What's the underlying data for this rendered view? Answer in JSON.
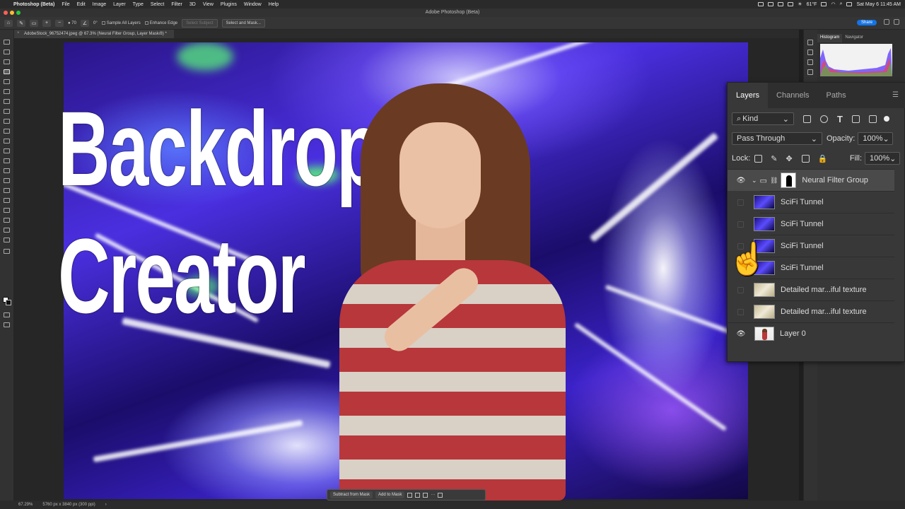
{
  "menubar": {
    "app": "Photoshop (Beta)",
    "items": [
      "File",
      "Edit",
      "Image",
      "Layer",
      "Type",
      "Select",
      "Filter",
      "3D",
      "View",
      "Plugins",
      "Window",
      "Help"
    ],
    "weather": "61°F",
    "datetime": "Sat May 6  11:45 AM"
  },
  "window": {
    "title": "Adobe Photoshop (Beta)"
  },
  "options": {
    "sample_all_layers": "Sample All Layers",
    "enhance_edge": "Enhance Edge",
    "select_subject": "Select Subject",
    "select_and_mask": "Select and Mask...",
    "brush_size": "70",
    "angle": "0°",
    "share": "Share"
  },
  "doc": {
    "tab_title": "AdobeStock_96752474.jpeg @ 67.3% (Neural Filter Group, Layer Mask/8) *"
  },
  "canvas": {
    "headline_line1": "Backdrop",
    "headline_line2": "Creator"
  },
  "maskbar": {
    "subtract": "Subtract from Mask",
    "add": "Add to Mask"
  },
  "status": {
    "zoom": "67.29%",
    "dimensions": "5760 px x 3840 px (300 ppi)"
  },
  "histogram": {
    "tab_histogram": "Histogram",
    "tab_navigator": "Navigator"
  },
  "layers": {
    "tabs": [
      "Layers",
      "Channels",
      "Paths"
    ],
    "filter_kind": "Kind",
    "blend_mode": "Pass Through",
    "opacity_label": "Opacity:",
    "opacity_value": "100%",
    "lock_label": "Lock:",
    "fill_label": "Fill:",
    "fill_value": "100%",
    "items": [
      {
        "name": "Neural Filter Group",
        "visible": true,
        "type": "group"
      },
      {
        "name": "SciFi Tunnel",
        "visible": false,
        "type": "tunnel"
      },
      {
        "name": "SciFi Tunnel",
        "visible": false,
        "type": "tunnel"
      },
      {
        "name": "SciFi Tunnel",
        "visible": false,
        "type": "tunnel"
      },
      {
        "name": "SciFi Tunnel",
        "visible": false,
        "type": "tunnel"
      },
      {
        "name": "Detailed mar...iful texture",
        "visible": false,
        "type": "marble"
      },
      {
        "name": "Detailed mar...iful texture",
        "visible": false,
        "type": "marble"
      },
      {
        "name": "Layer 0",
        "visible": true,
        "type": "person"
      }
    ]
  },
  "colors": {
    "accent": "#1473e6",
    "shirt_red": "#b7373a",
    "tunnel_purple": "#4a2fe0"
  }
}
